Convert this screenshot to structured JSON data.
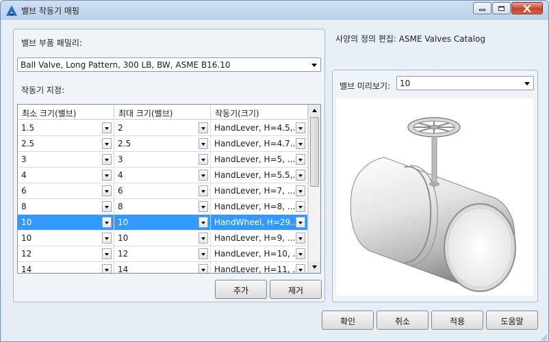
{
  "window": {
    "title": "밸브 작동기 매핑",
    "app_icon": "autocad-plant-icon"
  },
  "left": {
    "family_label": "밸브 부품 패밀리:",
    "family_value": "Ball Valve, Long Pattern, 300 LB, BW, ASME B16.10",
    "actuator_label": "작동기 지정:",
    "columns": [
      "최소 크기(밸브)",
      "최대 크기(밸브)",
      "작동기(크기)"
    ],
    "rows": [
      [
        "1.5",
        "2",
        "HandLever, H=4.5,..."
      ],
      [
        "2.5",
        "2.5",
        "HandLever, H=4.7..."
      ],
      [
        "3",
        "3",
        "HandLever, H=5, ..."
      ],
      [
        "4",
        "4",
        "HandLever, H=5.5,..."
      ],
      [
        "6",
        "6",
        "HandLever, H=7, ..."
      ],
      [
        "8",
        "8",
        "HandLever, H=8, ..."
      ],
      [
        "10",
        "10",
        "HandWheel, H=29...."
      ],
      [
        "10",
        "10",
        "HandLever, H=9, ..."
      ],
      [
        "12",
        "12",
        "HandLever, H=10, ..."
      ],
      [
        "14",
        "14",
        "HandLever, H=11, ..."
      ]
    ],
    "selected_row": 6,
    "add_label": "추가",
    "remove_label": "제거"
  },
  "right": {
    "spec_label": "사양의 정의 편집: ASME Valves Catalog",
    "preview_label": "밸브 미리보기:",
    "preview_value": "10"
  },
  "footer": {
    "ok": "확인",
    "cancel": "취소",
    "apply": "적용",
    "help": "도움말"
  },
  "colors": {
    "selection": "#3399ff",
    "close_button": "#c7462c"
  }
}
